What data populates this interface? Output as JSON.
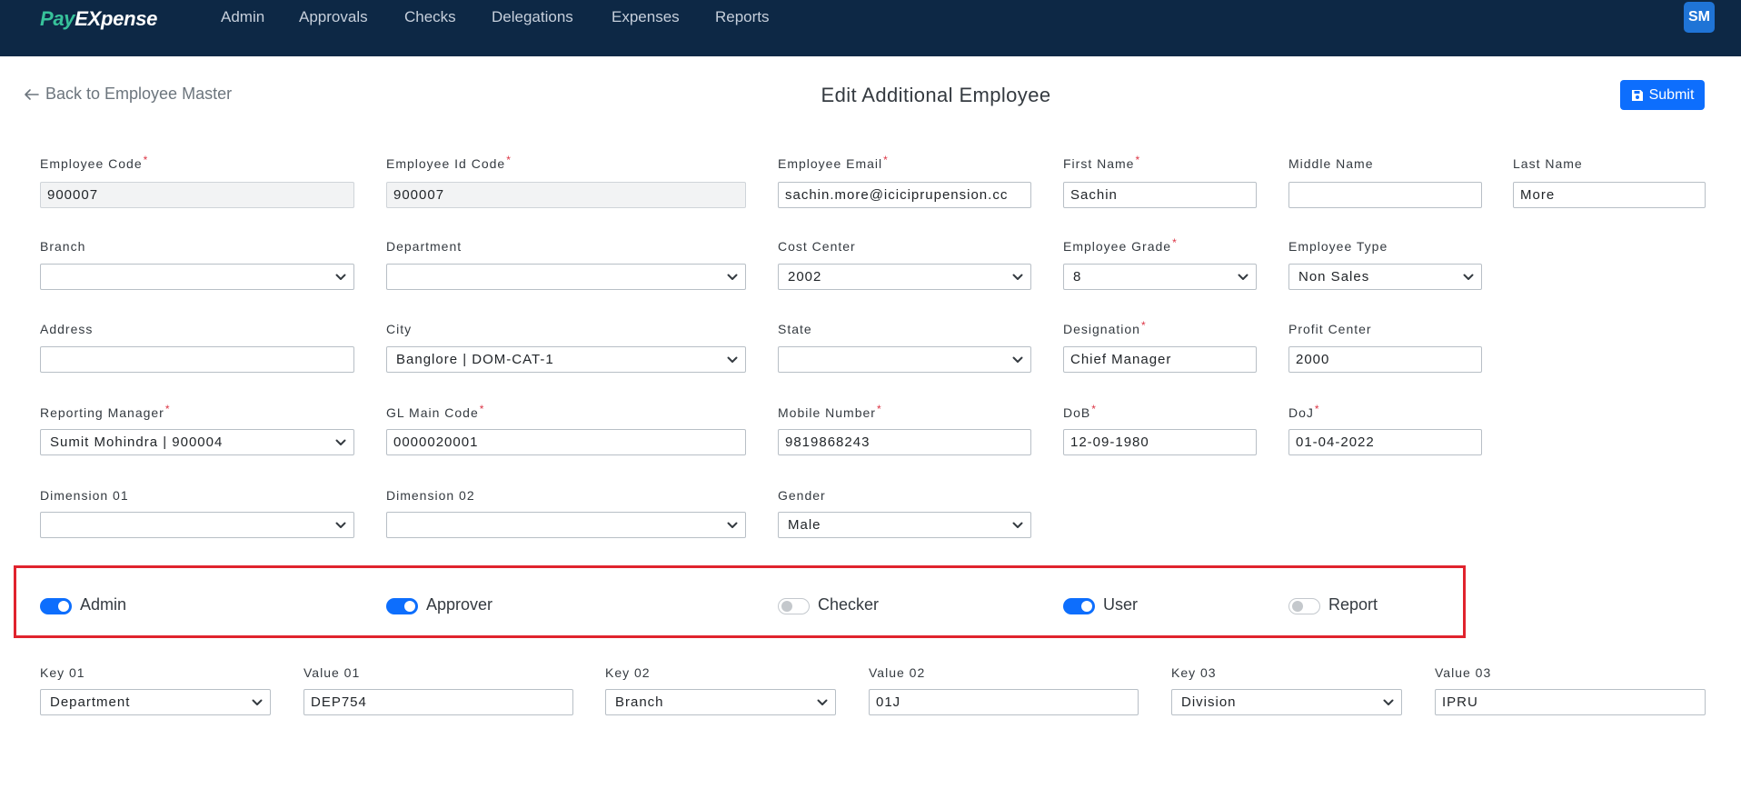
{
  "header": {
    "logo_pay": "Pay",
    "logo_expense": "EXpense",
    "nav": [
      "Admin",
      "Approvals",
      "Checks",
      "Delegations",
      "Expenses",
      "Reports"
    ],
    "avatar_initials": "SM"
  },
  "page": {
    "back_label": "Back to Employee Master",
    "title": "Edit Additional Employee",
    "submit_label": "Submit"
  },
  "form": {
    "employee_code": {
      "label": "Employee Code",
      "value": "900007"
    },
    "employee_id_code": {
      "label": "Employee Id Code",
      "value": "900007"
    },
    "employee_email": {
      "label": "Employee Email",
      "value": "sachin.more@iciciprupension.cc"
    },
    "first_name": {
      "label": "First Name",
      "value": "Sachin"
    },
    "middle_name": {
      "label": "Middle Name",
      "value": ""
    },
    "last_name": {
      "label": "Last Name",
      "value": "More"
    },
    "branch": {
      "label": "Branch",
      "value": ""
    },
    "department": {
      "label": "Department",
      "value": ""
    },
    "cost_center": {
      "label": "Cost Center",
      "value": "2002"
    },
    "employee_grade": {
      "label": "Employee Grade",
      "value": "8"
    },
    "employee_type": {
      "label": "Employee Type",
      "value": "Non Sales"
    },
    "address": {
      "label": "Address",
      "value": ""
    },
    "city": {
      "label": "City",
      "value": "Banglore | DOM-CAT-1"
    },
    "state": {
      "label": "State",
      "value": ""
    },
    "designation": {
      "label": "Designation",
      "value": "Chief Manager"
    },
    "profit_center": {
      "label": "Profit Center",
      "value": "2000"
    },
    "reporting_manager": {
      "label": "Reporting Manager",
      "value": "Sumit Mohindra | 900004"
    },
    "gl_main_code": {
      "label": "GL Main Code",
      "value": "0000020001"
    },
    "mobile_number": {
      "label": "Mobile Number",
      "value": "9819868243"
    },
    "dob": {
      "label": "DoB",
      "value": "12-09-1980"
    },
    "doj": {
      "label": "DoJ",
      "value": "01-04-2022"
    },
    "dimension_01": {
      "label": "Dimension 01",
      "value": ""
    },
    "dimension_02": {
      "label": "Dimension 02",
      "value": ""
    },
    "gender": {
      "label": "Gender",
      "value": "Male"
    }
  },
  "roles": [
    {
      "label": "Admin",
      "on": true
    },
    {
      "label": "Approver",
      "on": true
    },
    {
      "label": "Checker",
      "on": false
    },
    {
      "label": "User",
      "on": true
    },
    {
      "label": "Report",
      "on": false
    }
  ],
  "keys": {
    "key01": {
      "label": "Key 01",
      "value": "Department"
    },
    "value01": {
      "label": "Value 01",
      "value": "DEP754"
    },
    "key02": {
      "label": "Key 02",
      "value": "Branch"
    },
    "value02": {
      "label": "Value 02",
      "value": "01J"
    },
    "key03": {
      "label": "Key 03",
      "value": "Division"
    },
    "value03": {
      "label": "Value 03",
      "value": "IPRU"
    }
  },
  "required_marker": "*",
  "colors": {
    "header_bg": "#0d2845",
    "primary": "#0d6efd",
    "highlight": "#e0232d",
    "logo_green": "#37c29a"
  }
}
